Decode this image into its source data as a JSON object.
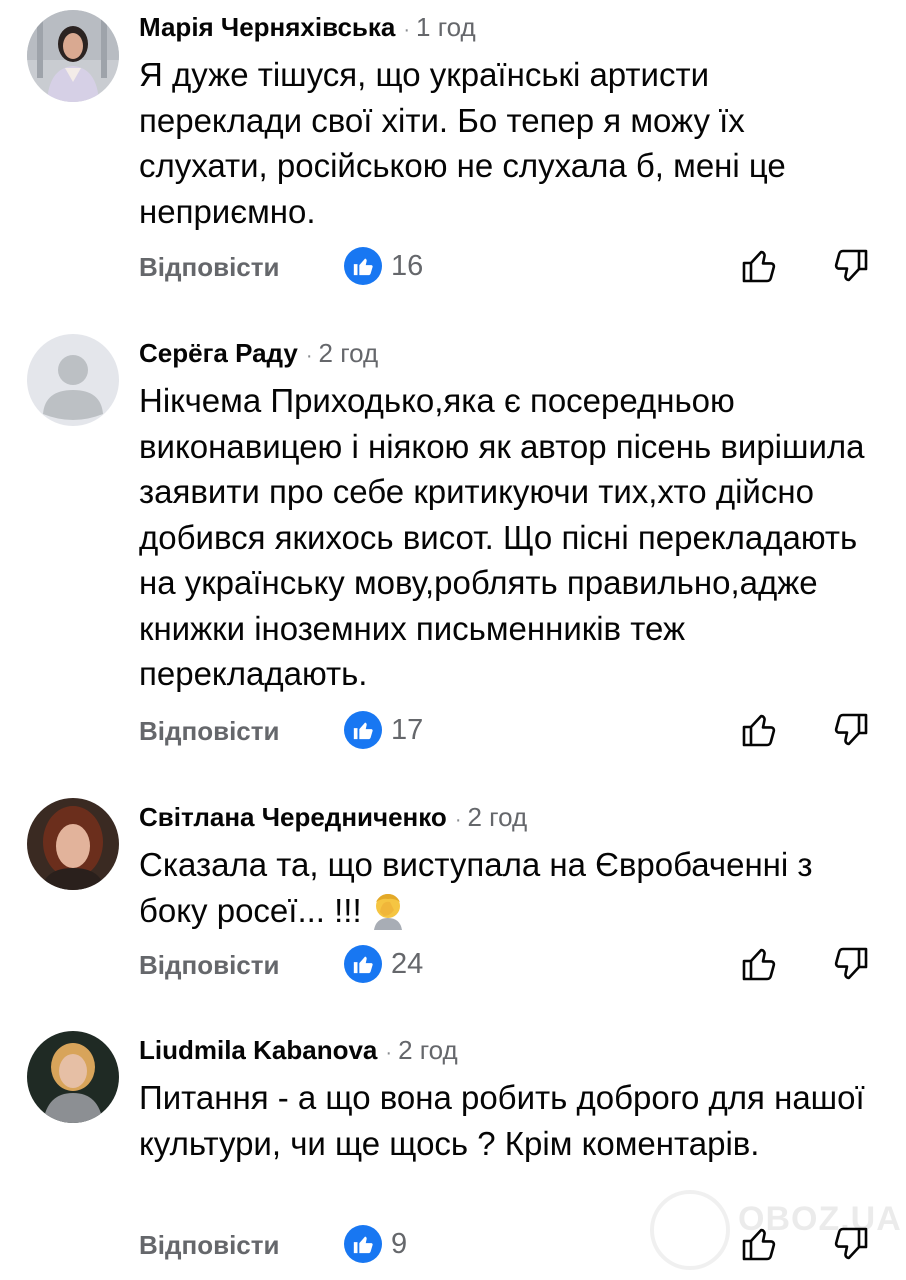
{
  "colors": {
    "accent": "#1877f2",
    "secondary_text": "#65676b"
  },
  "comments": [
    {
      "author": "Марія Черняхівська",
      "time": "1 год",
      "text": "Я дуже тішуся, що українські артисти переклади свої хіти. Бо тепер я можу їх слухати, російською не слухала б, мені це неприємно.",
      "reply_label": "Відповісти",
      "likes": "16",
      "emoji": ""
    },
    {
      "author": "Серёга Раду",
      "time": "2 год",
      "text": "Нікчема Приходько,яка є посередньою виконавицею і ніякою як автор пісень вирішила заявити про себе критикуючи тих,хто дійсно добився якихось висот. Що пісні перекладають на українську мову,роблять правильно,адже книжки іноземних письменників теж перекладають.",
      "reply_label": "Відповісти",
      "likes": "17",
      "emoji": ""
    },
    {
      "author": "Світлана Чередниченко",
      "time": "2 год",
      "text": "Сказала та, що виступала на Євробаченні з боку росеї... !!!",
      "reply_label": "Відповісти",
      "likes": "24",
      "emoji": "facepalm"
    },
    {
      "author": "Liudmila Kabanova",
      "time": "2 год",
      "text": "Питання - а що вона робить доброго для нашої культури, чи ще щось ? Крім коментарів.",
      "reply_label": "Відповісти",
      "likes": "9",
      "emoji": ""
    }
  ],
  "watermark": "OBOZ.UA"
}
